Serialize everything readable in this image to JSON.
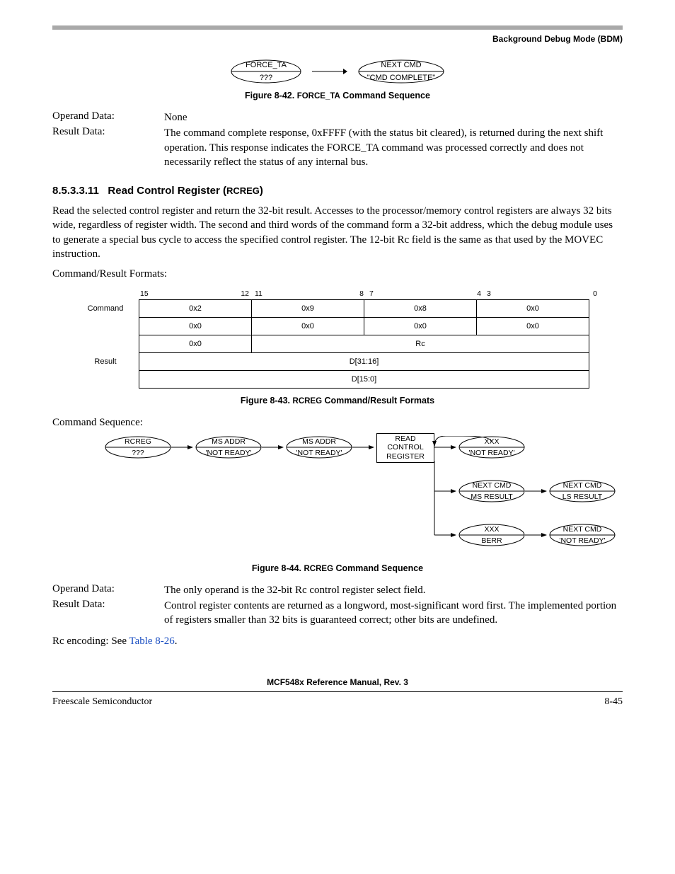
{
  "header": {
    "title": "Background Debug Mode (BDM)"
  },
  "diag1": {
    "left": {
      "top": "FORCE_TA",
      "bottom": "???"
    },
    "right": {
      "top": "NEXT CMD",
      "bottom": "\"CMD COMPLETE\""
    },
    "caption_prefix": "Figure 8-42. ",
    "caption_cmd": "FORCE_TA",
    "caption_suffix": " Command Sequence"
  },
  "def1": {
    "operand_label": "Operand Data:",
    "operand_value": "None",
    "result_label": "Result Data:",
    "result_value": "The command complete response, 0xFFFF (with the status bit cleared), is returned during the next shift operation. This response indicates the FORCE_TA command was processed correctly and does not necessarily reflect the status of any internal bus."
  },
  "section": {
    "number": "8.5.3.3.11",
    "title_prefix": "Read Control Register (",
    "title_cmd": "RCREG",
    "title_suffix": ")",
    "body": "Read the selected control register and return the 32-bit result. Accesses to the processor/memory control registers are always 32 bits wide, regardless of register width. The second and third words of the command form a 32-bit address, which the debug module uses to generate a special bus cycle to access the specified control register. The 12-bit Rc field is the same as that used by the MOVEC instruction.",
    "crf_label": "Command/Result Formats:",
    "cs_label": "Command Sequence:"
  },
  "bits": {
    "headers": [
      "15",
      "12",
      "11",
      "8",
      "7",
      "4",
      "3",
      "0"
    ],
    "row_cmd_label": "Command",
    "row_result_label": "Result",
    "r1": [
      "0x2",
      "0x9",
      "0x8",
      "0x0"
    ],
    "r2": [
      "0x0",
      "0x0",
      "0x0",
      "0x0"
    ],
    "r3a": "0x0",
    "r3b": "Rc",
    "r4": "D[31:16]",
    "r5": "D[15:0]",
    "caption_prefix": "Figure 8-43. ",
    "caption_cmd": "RCREG",
    "caption_suffix": " Command/Result Formats"
  },
  "diag2": {
    "n1": {
      "top": "RCREG",
      "bottom": "???"
    },
    "n2": {
      "top": "MS ADDR",
      "bottom": "'NOT READY'"
    },
    "n3": {
      "top": "MS ADDR",
      "bottom": "'NOT READY'"
    },
    "rect": {
      "l1": "READ",
      "l2": "CONTROL",
      "l3": "REGISTER"
    },
    "n5": {
      "top": "XXX",
      "bottom": "'NOT READY'"
    },
    "n6": {
      "top": "NEXT CMD",
      "bottom": "MS RESULT"
    },
    "n7": {
      "top": "NEXT CMD",
      "bottom": "LS RESULT"
    },
    "n8": {
      "top": "XXX",
      "bottom": "BERR"
    },
    "n9": {
      "top": "NEXT CMD",
      "bottom": "'NOT READY'"
    },
    "caption_prefix": "Figure 8-44. ",
    "caption_cmd": "RCREG",
    "caption_suffix": " Command Sequence"
  },
  "def2": {
    "operand_label": "Operand Data:",
    "operand_value": "The only operand is the 32-bit Rc control register select field.",
    "result_label": "Result Data:",
    "result_value": "Control register contents are returned as a longword, most-significant word first. The implemented portion of registers smaller than 32 bits is guaranteed correct; other bits are undefined."
  },
  "rc_encoding": {
    "prefix": "Rc encoding: See ",
    "link": "Table 8-26",
    "suffix": "."
  },
  "footer": {
    "manual": "MCF548x Reference Manual, Rev. 3",
    "left": "Freescale Semiconductor",
    "right": "8-45"
  }
}
